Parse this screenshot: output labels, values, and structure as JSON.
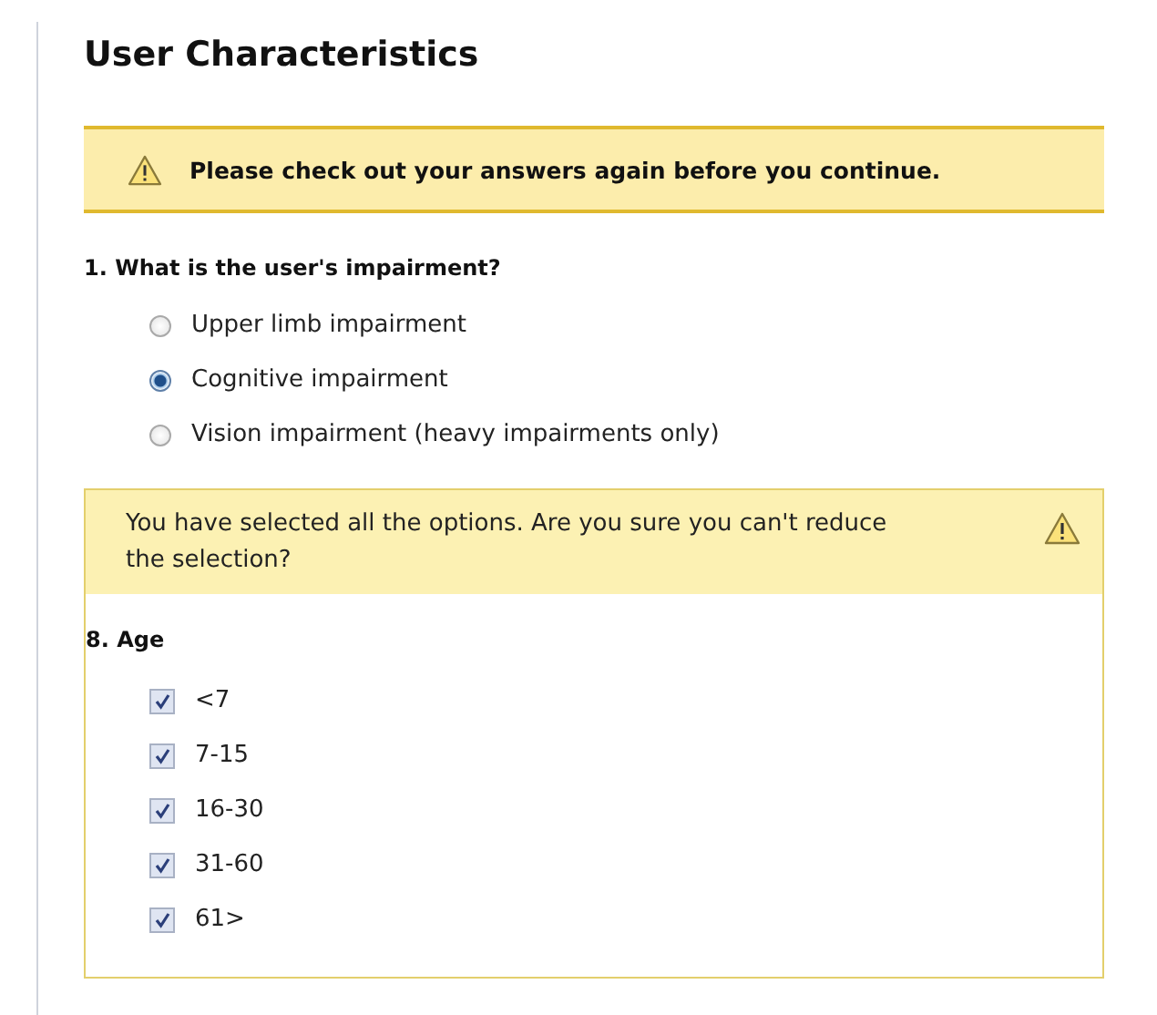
{
  "title": "User Characteristics",
  "notice": "Please check out your answers again before you continue.",
  "question_1": {
    "label": "1. What is the user's impairment?",
    "options": [
      {
        "label": "Upper limb impairment",
        "selected": false
      },
      {
        "label": "Cognitive impairment",
        "selected": true
      },
      {
        "label": "Vision impairment (heavy impairments only)",
        "selected": false
      }
    ]
  },
  "warning": "You have selected all the options. Are you sure you can't reduce the selection?",
  "question_8": {
    "label": "8. Age",
    "options": [
      {
        "label": "<7",
        "checked": true
      },
      {
        "label": "7-15",
        "checked": true
      },
      {
        "label": "16-30",
        "checked": true
      },
      {
        "label": "31-60",
        "checked": true
      },
      {
        "label": "61>",
        "checked": true
      }
    ]
  }
}
